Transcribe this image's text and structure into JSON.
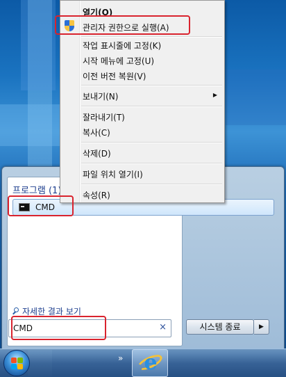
{
  "context_menu": {
    "items": [
      {
        "label": "열기(O)",
        "bold": true
      },
      {
        "label": "관리자 권한으로 실행(A)",
        "icon": "uac-shield-icon"
      },
      {
        "label": "작업 표시줄에 고정(K)"
      },
      {
        "label": "시작 메뉴에 고정(U)"
      },
      {
        "label": "이전 버전 복원(V)"
      },
      {
        "label": "보내기(N)",
        "submenu": true
      },
      {
        "label": "잘라내기(T)"
      },
      {
        "label": "복사(C)"
      },
      {
        "label": "삭제(D)"
      },
      {
        "label": "파일 위치 열기(I)"
      },
      {
        "label": "속성(R)"
      }
    ]
  },
  "start_menu": {
    "section_heading": "프로그램 (1)",
    "program_result": {
      "label": "CMD",
      "icon": "command-prompt-icon"
    },
    "see_more": "자세한 결과 보기",
    "search": {
      "value": "CMD",
      "clear_glyph": "×"
    },
    "shutdown_label": "시스템 종료",
    "shutdown_arrow": "▶"
  },
  "taskbar": {
    "overflow_glyph": "»",
    "pinned": [
      {
        "icon": "internet-explorer-icon",
        "glyph": "e"
      }
    ]
  },
  "colors": {
    "highlight": "#d9232e",
    "menu_bg": "#f0f0f0",
    "link_blue": "#1e3f8f"
  }
}
